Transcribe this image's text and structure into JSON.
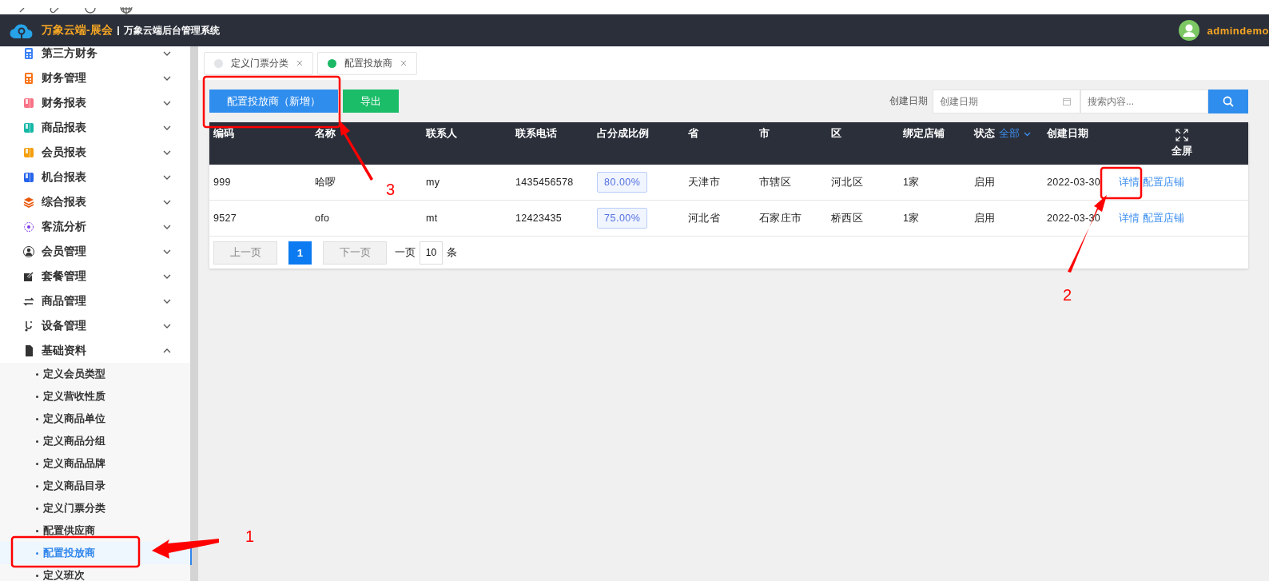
{
  "header": {
    "brand": "万象云端-展会",
    "subtitle": "万象云端后台管理系统",
    "user": "admindemo"
  },
  "sidebar": {
    "items": [
      {
        "label": "第三方财务",
        "expanded": false
      },
      {
        "label": "财务管理",
        "expanded": false
      },
      {
        "label": "财务报表",
        "expanded": false
      },
      {
        "label": "商品报表",
        "expanded": false
      },
      {
        "label": "会员报表",
        "expanded": false
      },
      {
        "label": "机台报表",
        "expanded": false
      },
      {
        "label": "综合报表",
        "expanded": false
      },
      {
        "label": "客流分析",
        "expanded": false
      },
      {
        "label": "会员管理",
        "expanded": false
      },
      {
        "label": "套餐管理",
        "expanded": false
      },
      {
        "label": "商品管理",
        "expanded": false
      },
      {
        "label": "设备管理",
        "expanded": false
      },
      {
        "label": "基础资料",
        "expanded": true,
        "children": [
          {
            "label": "定义会员类型",
            "selected": false
          },
          {
            "label": "定义营收性质",
            "selected": false
          },
          {
            "label": "定义商品单位",
            "selected": false
          },
          {
            "label": "定义商品分组",
            "selected": false
          },
          {
            "label": "定义商品品牌",
            "selected": false
          },
          {
            "label": "定义商品目录",
            "selected": false
          },
          {
            "label": "定义门票分类",
            "selected": false
          },
          {
            "label": "配置供应商",
            "selected": false
          },
          {
            "label": "配置投放商",
            "selected": true
          },
          {
            "label": "定义班次",
            "selected": false
          }
        ]
      }
    ]
  },
  "tabs": [
    {
      "label": "定义门票分类",
      "selected": false
    },
    {
      "label": "配置投放商",
      "selected": true
    }
  ],
  "toolbar": {
    "add_button": "配置投放商（新增）",
    "export_button": "导出",
    "date_label": "创建日期",
    "date_field": {
      "placeholder": "创建日期"
    },
    "search_field": {
      "placeholder": "搜索内容..."
    }
  },
  "table": {
    "columns": [
      {
        "label": "编码"
      },
      {
        "label": "名称"
      },
      {
        "label": "联系人"
      },
      {
        "label": "联系电话"
      },
      {
        "label": "占分成比例"
      },
      {
        "label": "省"
      },
      {
        "label": "市"
      },
      {
        "label": "区"
      },
      {
        "label": "绑定店铺"
      },
      {
        "label": "状态",
        "filter": "全部"
      },
      {
        "label": "创建日期"
      },
      {
        "label": "全屏",
        "kind": "fullscreen"
      }
    ],
    "rows": [
      {
        "cells": [
          "999",
          "哈啰",
          "my",
          "1435456578"
        ],
        "ratio": "80.00%",
        "cells2": [
          "天津市",
          "市辖区",
          "河北区",
          "1家",
          "启用",
          "2022-03-30"
        ],
        "actions": [
          "详情",
          "配置店铺"
        ]
      },
      {
        "cells": [
          "9527",
          "ofo",
          "mt",
          "12423435"
        ],
        "ratio": "75.00%",
        "cells2": [
          "河北省",
          "石家庄市",
          "桥西区",
          "1家",
          "启用",
          "2022-03-30"
        ],
        "actions": [
          "详情",
          "配置店铺"
        ]
      }
    ]
  },
  "pagination": {
    "prev": {
      "label": "上一页",
      "disabled": true
    },
    "pages": [
      {
        "label": "1",
        "selected": true
      }
    ],
    "next": {
      "label": "下一页",
      "disabled": true
    },
    "per_page_label": "一页",
    "per_page": "10",
    "unit": "条"
  },
  "annotations": [
    {
      "number": "1"
    },
    {
      "number": "2"
    },
    {
      "number": "3"
    }
  ]
}
